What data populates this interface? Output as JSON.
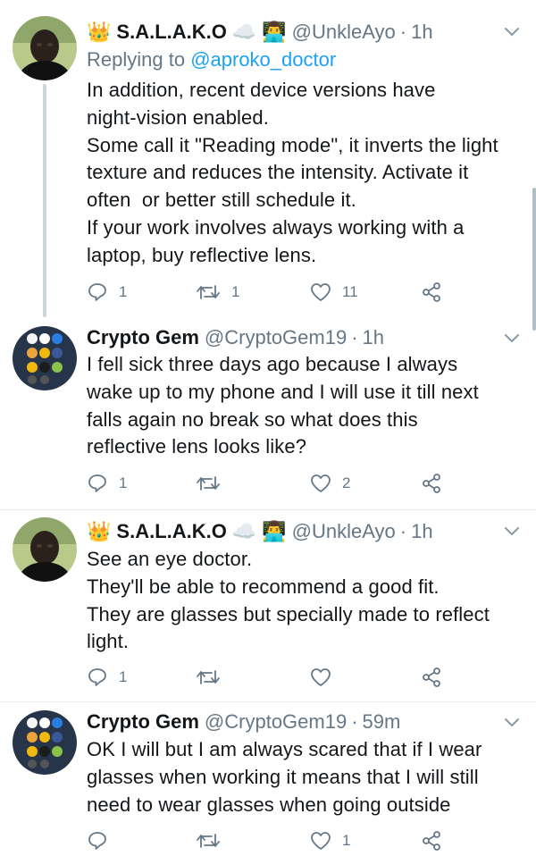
{
  "tweets": [
    {
      "name": "S.A.L.A.K.O",
      "name_emoji_before": "👑",
      "name_emoji_after": "☁️",
      "handle_emoji": "👨‍💻",
      "handle": "@UnkleAyo",
      "time": "1h",
      "reply_prefix": "Replying to ",
      "reply_to": "@aproko_doctor",
      "text": "In addition, recent device versions have\nnight-vision enabled.\nSome call it \"Reading mode\", it inverts the light\ntexture and reduces the intensity. Activate it\noften  or better still schedule it.\nIf your work involves always working with a\nlaptop, buy reflective lens.",
      "replies": "1",
      "retweets": "1",
      "likes": "11"
    },
    {
      "name": "Crypto Gem",
      "handle": "@CryptoGem19",
      "time": "1h",
      "text": "I fell sick three days ago because I always\nwake up to my phone and I will use it till next\nfalls again no break so what does this\nreflective lens looks like?",
      "replies": "1",
      "retweets": "",
      "likes": "2"
    },
    {
      "name": "S.A.L.A.K.O",
      "name_emoji_before": "👑",
      "name_emoji_after": "☁️",
      "handle_emoji": "👨‍💻",
      "handle": "@UnkleAyo",
      "time": "1h",
      "text": "See an eye doctor.\nThey'll be able to recommend a good fit.\nThey are glasses but specially made to reflect\nlight.",
      "replies": "1",
      "retweets": "",
      "likes": ""
    },
    {
      "name": "Crypto Gem",
      "handle": "@CryptoGem19",
      "time": "59m",
      "text": "OK I will but I am always scared that if I wear\nglasses when working it means that I will still\nneed to wear glasses when going outside",
      "replies": "",
      "retweets": "",
      "likes": "1"
    }
  ],
  "separator": "·",
  "icons": {
    "reply": "reply-icon",
    "retweet": "retweet-icon",
    "like": "heart-icon",
    "share": "share-icon",
    "more": "chevron-down-icon"
  },
  "colors": {
    "text": "#14171a",
    "secondary": "#657786",
    "link": "#1da1f2",
    "thread_line": "#ccd6dd"
  }
}
